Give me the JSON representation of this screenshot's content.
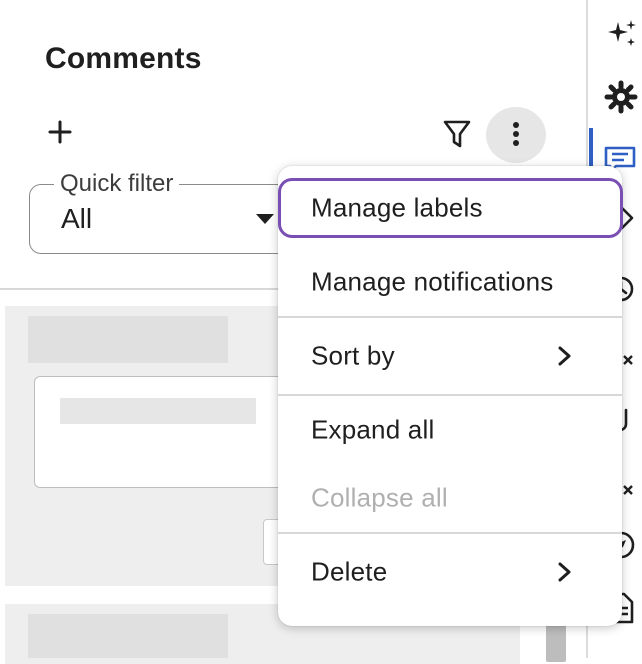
{
  "panel": {
    "title": "Comments",
    "quick_filter": {
      "label": "Quick filter",
      "value": "All"
    }
  },
  "toolbar": {
    "add_icon": "plus-icon",
    "filter_icon": "funnel-icon",
    "more_icon": "more-vertical-icon"
  },
  "menu": {
    "items": [
      {
        "label": "Manage labels",
        "focused": true
      },
      {
        "label": "Manage notifications"
      },
      {
        "label": "Sort by",
        "submenu": true
      },
      {
        "label": "Expand all"
      },
      {
        "label": "Collapse all",
        "disabled": true
      },
      {
        "label": "Delete",
        "submenu": true
      }
    ]
  },
  "right_rail": {
    "icons": [
      "sparkle-icon",
      "gear-icon",
      "comments-icon",
      "tag-icon",
      "history-icon",
      "checklist-icon",
      "attachment-icon",
      "tasks-icon",
      "compass-icon",
      "document-icon"
    ],
    "active": "comments-icon"
  },
  "colors": {
    "accent_focus": "#7a4fb3",
    "rail_active": "#2f5fc4",
    "disabled_text": "#b0b0b0"
  }
}
